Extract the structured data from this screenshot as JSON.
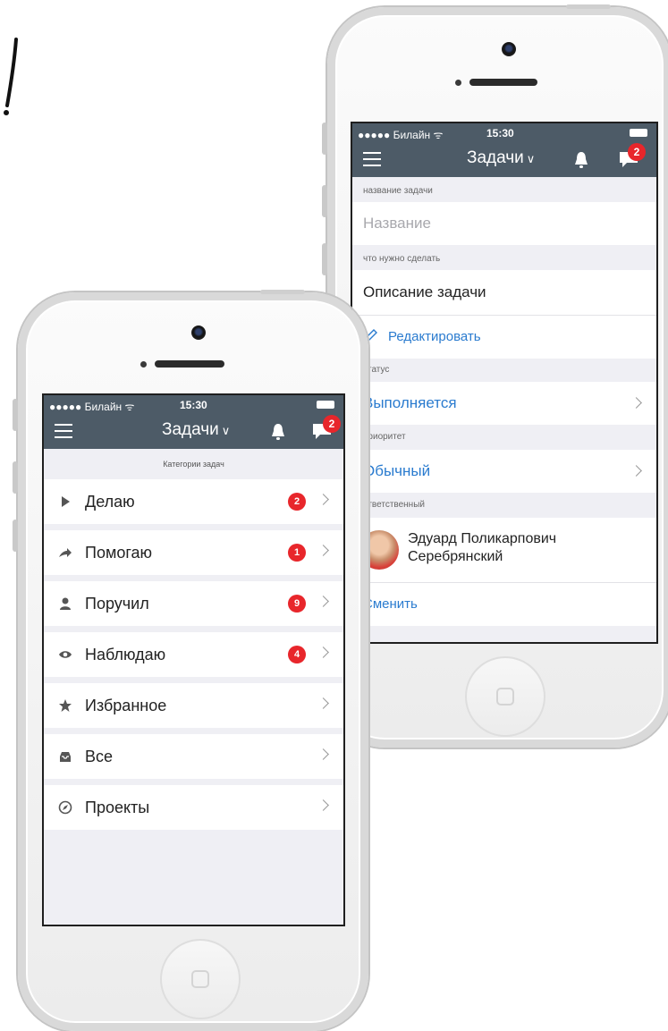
{
  "left_phone": {
    "status": {
      "carrier": "●●●●● Билайн ᯤ",
      "time": "15:30"
    },
    "nav": {
      "title": "Задачи",
      "badge": "2"
    },
    "header": "Категории задач",
    "items": [
      {
        "label": "Делаю",
        "count": "2",
        "icon": "play-icon"
      },
      {
        "label": "Помогаю",
        "count": "1",
        "icon": "arrow-right-icon"
      },
      {
        "label": "Поручил",
        "count": "9",
        "icon": "person-icon"
      },
      {
        "label": "Наблюдаю",
        "count": "4",
        "icon": "eye-icon"
      },
      {
        "label": "Избранное",
        "count": "",
        "icon": "star-icon"
      },
      {
        "label": "Все",
        "count": "",
        "icon": "inbox-icon"
      },
      {
        "label": "Проекты",
        "count": "",
        "icon": "compass-icon"
      }
    ]
  },
  "right_phone": {
    "status": {
      "carrier": "●●●●● Билайн ᯤ",
      "time": "15:30"
    },
    "nav": {
      "title": "Задачи",
      "badge": "2"
    },
    "task_name": {
      "label": "название задачи",
      "placeholder": "Название"
    },
    "todo": {
      "label": "что нужно сделать",
      "value": "Описание задачи",
      "edit": "Редактировать"
    },
    "status_field": {
      "label": "статус",
      "value": "Выполняется"
    },
    "priority": {
      "label": "приоритет",
      "value": "Обычный"
    },
    "responsible": {
      "label": "ответственный",
      "name_line1": "Эдуард Поликарпович",
      "name_line2": "Серебрянский",
      "change": "Сменить"
    }
  },
  "colors": {
    "navbar": "#4d5b67",
    "badge": "#e8262b",
    "link": "#2a7bcf",
    "background": "#efeff4"
  }
}
